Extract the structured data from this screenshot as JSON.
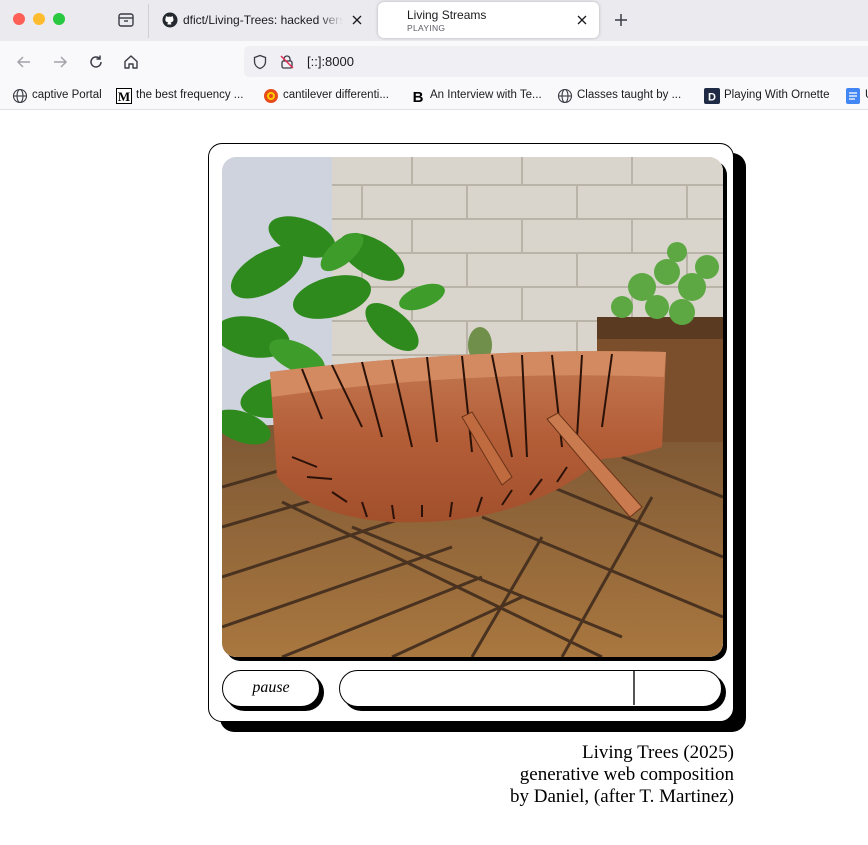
{
  "browser": {
    "tabs": [
      {
        "title": "dfict/Living-Trees: hacked versi",
        "active": false,
        "icon": "github-icon"
      },
      {
        "title": "Living Streams",
        "subtitle": "PLAYING",
        "active": true
      }
    ],
    "url": "[::]:8000",
    "bookmarks": [
      {
        "label": "captive Portal",
        "icon": "globe-icon"
      },
      {
        "label": "the best frequency ...",
        "icon": "medium-icon"
      },
      {
        "label": "cantilever differenti...",
        "icon": "flower-icon"
      },
      {
        "label": "An Interview with Te...",
        "icon": "bold-b-icon"
      },
      {
        "label": "Classes taught by ...",
        "icon": "globe-icon"
      },
      {
        "label": "Playing With Ornette",
        "icon": "d-icon"
      },
      {
        "label": "U",
        "icon": "doc-icon"
      }
    ]
  },
  "player": {
    "pause_label": "pause",
    "progress": 0.77
  },
  "caption": {
    "line1": "Living Trees (2025)",
    "line2": "generative web composition",
    "line3": "by Daniel, (after T. Martinez)"
  },
  "colors": {
    "accent_black": "#000000",
    "wood": "#b5613a",
    "deck": "#9a6a3a",
    "brick": "#d8d4cc",
    "leaf": "#2f8a1e"
  }
}
